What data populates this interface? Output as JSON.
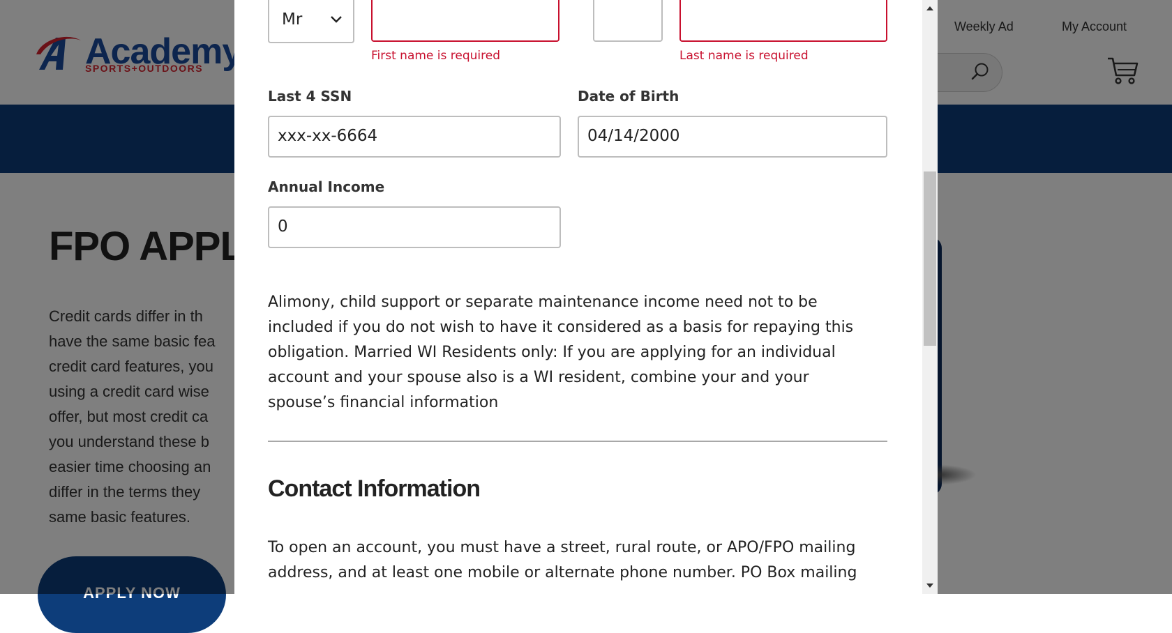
{
  "background_page": {
    "logo": {
      "brand": "Academy",
      "subtitle": "SPORTS+OUTDOORS"
    },
    "header_links": [
      "Weekly Ad",
      "My Account"
    ],
    "hero_title": "FPO APPLY",
    "hero_text_lines": [
      "Credit cards differ in th",
      "have the same basic fea",
      "credit card features, you",
      "using a credit card wise",
      "offer, but most credit ca",
      "you understand these b",
      "easier time choosing an",
      "differ in the terms they",
      "same basic features."
    ],
    "apply_button": "APPLY NOW",
    "colors": {
      "brand_blue": "#0d3d7a",
      "brand_red": "#d6232f",
      "overlay": "rgba(0,0,0,0.5)"
    }
  },
  "modal": {
    "name_row": {
      "prefix_value": "Mr",
      "first_name_value": "",
      "first_name_error": "First name is required",
      "middle_initial_value": "",
      "last_name_value": "",
      "last_name_error": "Last name is required"
    },
    "ssn": {
      "label": "Last 4 SSN",
      "value": "xxx-xx-6664"
    },
    "dob": {
      "label": "Date of Birth",
      "value": "04/14/2000"
    },
    "income": {
      "label": "Annual Income",
      "value": "0"
    },
    "disclaimer_lines": [
      "Alimony, child support or separate maintenance income need not to be",
      "included if you do not wish to have it  considered as a basis for repaying this",
      "obligation. Married WI Residents only: If you are applying for an individual",
      "account and your spouse also is a WI resident,  combine your and your",
      "spouse’s financial information"
    ],
    "contact_section": {
      "title": "Contact Information",
      "text_lines": [
        "To open an account, you must have a street, rural route, or APO/FPO mailing",
        "address, and at least one mobile or alternate phone number. PO Box mailing"
      ]
    },
    "colors": {
      "error": "#c8102e",
      "border": "#bdbdbd"
    }
  }
}
